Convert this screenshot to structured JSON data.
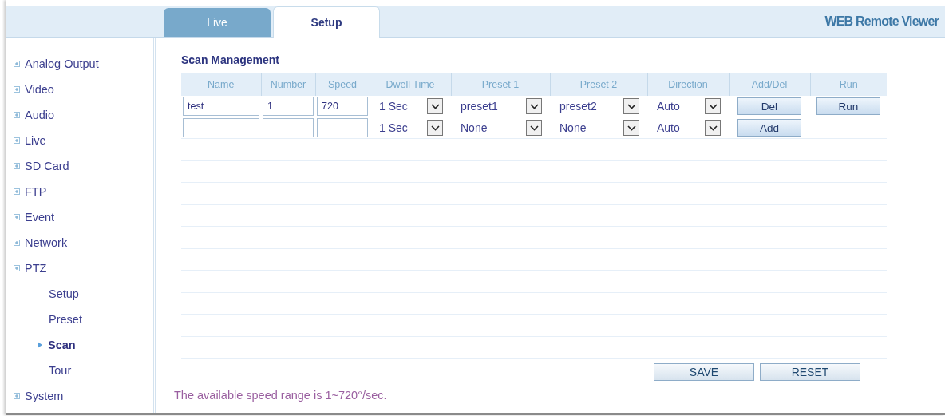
{
  "tabs": [
    {
      "label": "Live",
      "selected": false
    },
    {
      "label": "Setup",
      "selected": true
    }
  ],
  "app_title": "WEB Remote Viewer",
  "sidebar": {
    "items": [
      {
        "label": "Analog Output"
      },
      {
        "label": "Video"
      },
      {
        "label": "Audio"
      },
      {
        "label": "Live"
      },
      {
        "label": "SD Card"
      },
      {
        "label": "FTP"
      },
      {
        "label": "Event"
      },
      {
        "label": "Network"
      },
      {
        "label": "PTZ",
        "children": [
          {
            "label": "Setup",
            "selected": false
          },
          {
            "label": "Preset",
            "selected": false
          },
          {
            "label": "Scan",
            "selected": true
          },
          {
            "label": "Tour",
            "selected": false
          }
        ]
      },
      {
        "label": "System"
      }
    ]
  },
  "section_title": "Scan Management",
  "table": {
    "columns": [
      "Name",
      "Number",
      "Speed",
      "Dwell Time",
      "Preset 1",
      "Preset 2",
      "Direction",
      "Add/Del",
      "Run"
    ],
    "rows": [
      {
        "name": "test",
        "number": "1",
        "speed": "720",
        "dwell_time": "1 Sec",
        "preset_1": "preset1",
        "preset_2": "preset2",
        "direction": "Auto",
        "action": "Del",
        "run": "Run"
      },
      {
        "dwell_time": "1 Sec",
        "preset_1": "None",
        "preset_2": "None",
        "direction": "Auto",
        "action": "Add"
      }
    ]
  },
  "buttons": [
    "SAVE",
    "RESET"
  ],
  "note": "The available speed range is 1~720°/sec."
}
